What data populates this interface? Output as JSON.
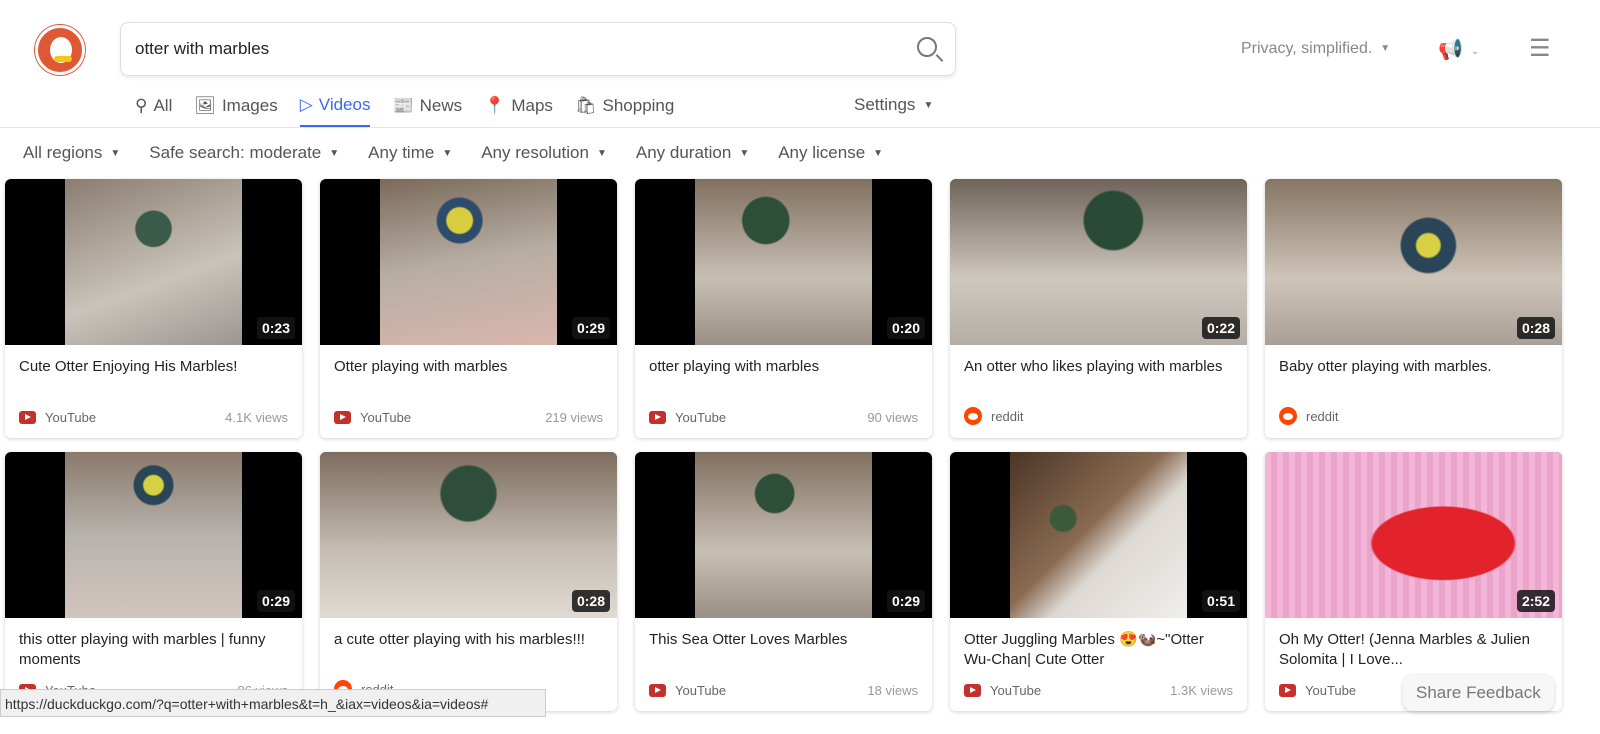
{
  "search": {
    "query": "otter with marbles"
  },
  "header": {
    "privacy": "Privacy, simplified.",
    "icons": [
      "megaphone-icon",
      "hamburger-menu-icon"
    ]
  },
  "tabs": [
    {
      "label": "All",
      "icon": "search-icon"
    },
    {
      "label": "Images",
      "icon": "image-icon"
    },
    {
      "label": "Videos",
      "icon": "play-icon",
      "active": true
    },
    {
      "label": "News",
      "icon": "newspaper-icon"
    },
    {
      "label": "Maps",
      "icon": "map-pin-icon"
    },
    {
      "label": "Shopping",
      "icon": "shopping-bag-icon"
    }
  ],
  "settings": "Settings",
  "filters": [
    "All regions",
    "Safe search: moderate",
    "Any time",
    "Any resolution",
    "Any duration",
    "Any license"
  ],
  "accent": "#3969ef",
  "videos": [
    {
      "title": "Cute Otter Enjoying His Marbles!",
      "duration": "0:23",
      "source": "YouTube",
      "views": "4.1K views"
    },
    {
      "title": "Otter playing with marbles",
      "duration": "0:29",
      "source": "YouTube",
      "views": "219 views"
    },
    {
      "title": "otter playing with marbles",
      "duration": "0:20",
      "source": "YouTube",
      "views": "90 views"
    },
    {
      "title": "An otter who likes playing with marbles",
      "duration": "0:22",
      "source": "reddit",
      "views": ""
    },
    {
      "title": "Baby otter playing with marbles.",
      "duration": "0:28",
      "source": "reddit",
      "views": ""
    },
    {
      "title": "this otter playing with marbles | funny moments",
      "duration": "0:29",
      "source": "YouTube",
      "views": "86 views"
    },
    {
      "title": "a cute otter playing with his marbles!!!",
      "duration": "0:28",
      "source": "reddit",
      "views": ""
    },
    {
      "title": "This Sea Otter Loves Marbles",
      "duration": "0:29",
      "source": "YouTube",
      "views": "18 views"
    },
    {
      "title": "Otter Juggling Marbles 😍🦦~\"Otter Wu-Chan| Cute Otter",
      "duration": "0:51",
      "source": "YouTube",
      "views": "1.3K views"
    },
    {
      "title": "Oh My Otter! (Jenna Marbles & Julien Solomita | I Love...",
      "duration": "2:52",
      "source": "YouTube",
      "views": ""
    }
  ],
  "status_url": "https://duckduckgo.com/?q=otter+with+marbles&t=h_&iax=videos&ia=videos#",
  "share_feedback": "Share Feedback"
}
